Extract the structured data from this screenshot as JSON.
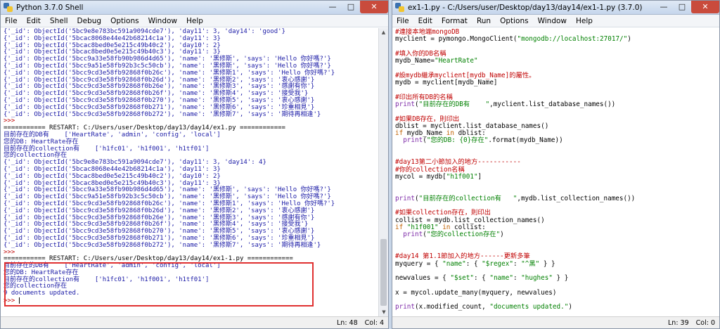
{
  "shell": {
    "title": "Python 3.7.0 Shell",
    "menu": [
      "File",
      "Edit",
      "Shell",
      "Debug",
      "Options",
      "Window",
      "Help"
    ],
    "status": {
      "ln": "Ln: 48",
      "col": "Col: 4"
    },
    "lines": [
      {
        "c": "blue",
        "t": "{'_id': ObjectId('5bc9e8e783bc591a9094cde7'), 'day11': 3, 'day14': 'good'}"
      },
      {
        "c": "blue",
        "t": "{'_id': ObjectId('5bcac8068e44e42b68214c1a'), 'day11': 3}"
      },
      {
        "c": "blue",
        "t": "{'_id': ObjectId('5bcac8bed0e5e215c49b40c2'), 'day10': 2}"
      },
      {
        "c": "blue",
        "t": "{'_id': ObjectId('5bcac8bed0e5e215c49b40c3'), 'day11': 3}"
      },
      {
        "c": "blue",
        "t": "{'_id': ObjectId('5bcc9a33e58fb90b986d4d65'), 'name': '黑修斯', 'says': 'Hello 你好嗎?'}"
      },
      {
        "c": "blue",
        "t": "{'_id': ObjectId('5bcc9a51e58fb92b3c5c50cb'), 'name': '黑修斯', 'says': 'Hello 你好嗎?'}"
      },
      {
        "c": "blue",
        "t": "{'_id': ObjectId('5bcc9cd3e58fb92868f0b26c'), 'name': '黑修斯1', 'says': 'Hello 你好嗎?'}"
      },
      {
        "c": "blue",
        "t": "{'_id': ObjectId('5bcc9cd3e58fb92868f0b26d'), 'name': '黑修斯2', 'says': '衷心感謝'}"
      },
      {
        "c": "blue",
        "t": "{'_id': ObjectId('5bcc9cd3e58fb92868f0b26e'), 'name': '黑修斯3', 'says': '感謝有你'}"
      },
      {
        "c": "blue",
        "t": "{'_id': ObjectId('5bcc9cd3e58fb92868f0b26f'), 'name': '黑修斯4', 'says': '接受我'}"
      },
      {
        "c": "blue",
        "t": "{'_id': ObjectId('5bcc9cd3e58fb92868f0b270'), 'name': '黑修斯5', 'says': '衷心感謝'}"
      },
      {
        "c": "blue",
        "t": "{'_id': ObjectId('5bcc9cd3e58fb92868f0b271'), 'name': '黑修斯6', 'says': '珍重相見'}"
      },
      {
        "c": "blue",
        "t": "{'_id': ObjectId('5bcc9cd3e58fb92868f0b272'), 'name': '黑修斯7', 'says': '期待再相逢'}"
      },
      {
        "c": "red",
        "t": ">>> "
      },
      {
        "c": "black",
        "t": "=========== RESTART: C:/Users/user/Desktop/day13/day14/ex1.py ============"
      },
      {
        "c": "blue",
        "t": "目前存在的DB有    ['HeartRate', 'admin', 'config', 'local']"
      },
      {
        "c": "blue",
        "t": "您的DB: HeartRate存在"
      },
      {
        "c": "blue",
        "t": "目前存在的collection有    ['h1fc01', 'h1f001', 'h1tf01']"
      },
      {
        "c": "blue",
        "t": "您的collection存在"
      },
      {
        "c": "blue",
        "t": "{'_id': ObjectId('5bc9e8e783bc591a9094cde7'), 'day11': 3, 'day14': 4}"
      },
      {
        "c": "blue",
        "t": "{'_id': ObjectId('5bcac8068e44e42b68214c1a'), 'day11': 3}"
      },
      {
        "c": "blue",
        "t": "{'_id': ObjectId('5bcac8bed0e5e215c49b40c2'), 'day10': 2}"
      },
      {
        "c": "blue",
        "t": "{'_id': ObjectId('5bcac8bed0e5e215c49b40c3'), 'day11': 3}"
      },
      {
        "c": "blue",
        "t": "{'_id': ObjectId('5bcc9a33e58fb90b986d4d65'), 'name': '黑修斯', 'says': 'Hello 你好嗎?'}"
      },
      {
        "c": "blue",
        "t": "{'_id': ObjectId('5bcc9a51e58fb92b3c5c50cb'), 'name': '黑修斯', 'says': 'Hello 你好嗎?'}"
      },
      {
        "c": "blue",
        "t": "{'_id': ObjectId('5bcc9cd3e58fb92868f0b26c'), 'name': '黑修斯1', 'says': 'Hello 你好嗎?'}"
      },
      {
        "c": "blue",
        "t": "{'_id': ObjectId('5bcc9cd3e58fb92868f0b26d'), 'name': '黑修斯2', 'says': '衷心感謝'}"
      },
      {
        "c": "blue",
        "t": "{'_id': ObjectId('5bcc9cd3e58fb92868f0b26e'), 'name': '黑修斯3', 'says': '感謝有你'}"
      },
      {
        "c": "blue",
        "t": "{'_id': ObjectId('5bcc9cd3e58fb92868f0b26f'), 'name': '黑修斯4', 'says': '接受我'}"
      },
      {
        "c": "blue",
        "t": "{'_id': ObjectId('5bcc9cd3e58fb92868f0b270'), 'name': '黑修斯5', 'says': '衷心感謝'}"
      },
      {
        "c": "blue",
        "t": "{'_id': ObjectId('5bcc9cd3e58fb92868f0b271'), 'name': '黑修斯6', 'says': '珍重相見'}"
      },
      {
        "c": "blue",
        "t": "{'_id': ObjectId('5bcc9cd3e58fb92868f0b272'), 'name': '黑修斯7', 'says': '期待再相逢'}"
      },
      {
        "c": "red",
        "t": ">>> "
      },
      {
        "c": "black",
        "t": "=========== RESTART: C:/Users/user/Desktop/day13/day14/ex1-1.py ============"
      },
      {
        "c": "blue",
        "t": "目前存在的DB有    ['HeartRate', 'admin', 'config', 'local']"
      },
      {
        "c": "blue",
        "t": "您的DB: HeartRate存在"
      },
      {
        "c": "blue",
        "t": "目前存在的collection有    ['h1fc01', 'h1f001', 'h1tf01']"
      },
      {
        "c": "blue",
        "t": "您的collection存在"
      },
      {
        "c": "blue",
        "t": "9 documents updated."
      },
      {
        "c": "red",
        "t": ">>> "
      }
    ]
  },
  "editor": {
    "title": "ex1-1.py - C:/Users/user/Desktop/day13/day14/ex1-1.py (3.7.0)",
    "menu": [
      "File",
      "Edit",
      "Format",
      "Run",
      "Options",
      "Window",
      "Help"
    ],
    "status": {
      "ln": "Ln: 39",
      "col": "Col: 0"
    },
    "lines": [
      [
        {
          "c": "red",
          "t": "#連接本地端mongoDB"
        }
      ],
      [
        {
          "c": "black",
          "t": "myclient = pymongo.MongoClient("
        },
        {
          "c": "green",
          "t": "\"mongodb://localhost:27017/\""
        },
        {
          "c": "black",
          "t": ")"
        }
      ],
      [
        {
          "c": "black",
          "t": ""
        }
      ],
      [
        {
          "c": "red",
          "t": "#填入你的DB名稱"
        }
      ],
      [
        {
          "c": "black",
          "t": "mydb_Name="
        },
        {
          "c": "green",
          "t": "\"HeartRate\""
        }
      ],
      [
        {
          "c": "black",
          "t": ""
        }
      ],
      [
        {
          "c": "red",
          "t": "#設mydb繼承myclient[mydb_Name]的屬性。"
        }
      ],
      [
        {
          "c": "black",
          "t": "mydb = myclient[mydb_Name]"
        }
      ],
      [
        {
          "c": "black",
          "t": ""
        }
      ],
      [
        {
          "c": "red",
          "t": "#印出所有DB的名稱"
        }
      ],
      [
        {
          "c": "purple",
          "t": "print"
        },
        {
          "c": "black",
          "t": "("
        },
        {
          "c": "green",
          "t": "\"目前存在的DB有    \""
        },
        {
          "c": "black",
          "t": ",myclient.list_database_names())"
        }
      ],
      [
        {
          "c": "black",
          "t": ""
        }
      ],
      [
        {
          "c": "red",
          "t": "#如果DB存在，則印出"
        }
      ],
      [
        {
          "c": "black",
          "t": "dblist = myclient.list_database_names()"
        }
      ],
      [
        {
          "c": "orange",
          "t": "if"
        },
        {
          "c": "black",
          "t": " mydb_Name "
        },
        {
          "c": "orange",
          "t": "in"
        },
        {
          "c": "black",
          "t": " dblist:"
        }
      ],
      [
        {
          "c": "black",
          "t": "  "
        },
        {
          "c": "purple",
          "t": "print"
        },
        {
          "c": "black",
          "t": "("
        },
        {
          "c": "green",
          "t": "\"您的DB: {0}存在\""
        },
        {
          "c": "black",
          "t": ".format(mydb_Name))"
        }
      ],
      [
        {
          "c": "black",
          "t": ""
        }
      ],
      [
        {
          "c": "black",
          "t": ""
        }
      ],
      [
        {
          "c": "red",
          "t": "#day13第二小節加入的地方-----------"
        }
      ],
      [
        {
          "c": "red",
          "t": "#你的collection名稱"
        }
      ],
      [
        {
          "c": "black",
          "t": "mycol = mydb["
        },
        {
          "c": "green",
          "t": "\"h1f001\""
        },
        {
          "c": "black",
          "t": "]"
        }
      ],
      [
        {
          "c": "black",
          "t": ""
        }
      ],
      [
        {
          "c": "black",
          "t": ""
        }
      ],
      [
        {
          "c": "purple",
          "t": "print"
        },
        {
          "c": "black",
          "t": "("
        },
        {
          "c": "green",
          "t": "\"目前存在的collection有   \""
        },
        {
          "c": "black",
          "t": ",mydb.list_collection_names())"
        }
      ],
      [
        {
          "c": "black",
          "t": ""
        }
      ],
      [
        {
          "c": "red",
          "t": "#如果collection存在，則印出"
        }
      ],
      [
        {
          "c": "black",
          "t": "collist = mydb.list_collection_names()"
        }
      ],
      [
        {
          "c": "orange",
          "t": "if"
        },
        {
          "c": "black",
          "t": " "
        },
        {
          "c": "green",
          "t": "\"h1f001\""
        },
        {
          "c": "black",
          "t": " "
        },
        {
          "c": "orange",
          "t": "in"
        },
        {
          "c": "black",
          "t": " collist:"
        }
      ],
      [
        {
          "c": "black",
          "t": "  "
        },
        {
          "c": "purple",
          "t": "print"
        },
        {
          "c": "black",
          "t": "("
        },
        {
          "c": "green",
          "t": "\"您的collection存在\""
        },
        {
          "c": "black",
          "t": ")"
        }
      ],
      [
        {
          "c": "black",
          "t": ""
        }
      ],
      [
        {
          "c": "black",
          "t": ""
        }
      ],
      [
        {
          "c": "red",
          "t": "#day14 第1.1節加入的地方------更新多筆"
        }
      ],
      [
        {
          "c": "black",
          "t": "myquery = { "
        },
        {
          "c": "green",
          "t": "\"name\""
        },
        {
          "c": "black",
          "t": ": { "
        },
        {
          "c": "green",
          "t": "\"$regex\""
        },
        {
          "c": "black",
          "t": ": "
        },
        {
          "c": "green",
          "t": "\"^黑\""
        },
        {
          "c": "black",
          "t": " } }"
        }
      ],
      [
        {
          "c": "black",
          "t": ""
        }
      ],
      [
        {
          "c": "black",
          "t": "newvalues = { "
        },
        {
          "c": "green",
          "t": "\"$set\""
        },
        {
          "c": "black",
          "t": ": { "
        },
        {
          "c": "green",
          "t": "\"name\""
        },
        {
          "c": "black",
          "t": ": "
        },
        {
          "c": "green",
          "t": "\"hughes\""
        },
        {
          "c": "black",
          "t": " } }"
        }
      ],
      [
        {
          "c": "black",
          "t": ""
        }
      ],
      [
        {
          "c": "black",
          "t": "x = mycol.update_many(myquery, newvalues)"
        }
      ],
      [
        {
          "c": "black",
          "t": ""
        }
      ],
      [
        {
          "c": "purple",
          "t": "print"
        },
        {
          "c": "black",
          "t": "(x.modified_count, "
        },
        {
          "c": "green",
          "t": "\"documents updated.\""
        },
        {
          "c": "black",
          "t": ")"
        }
      ]
    ]
  },
  "colors": {
    "desktop": "#c8d6e8",
    "highlight": "#e03030"
  },
  "icons": {
    "app": "python-idle-icon",
    "minimize": "minimize-icon",
    "maximize": "maximize-icon",
    "close": "close-icon"
  }
}
